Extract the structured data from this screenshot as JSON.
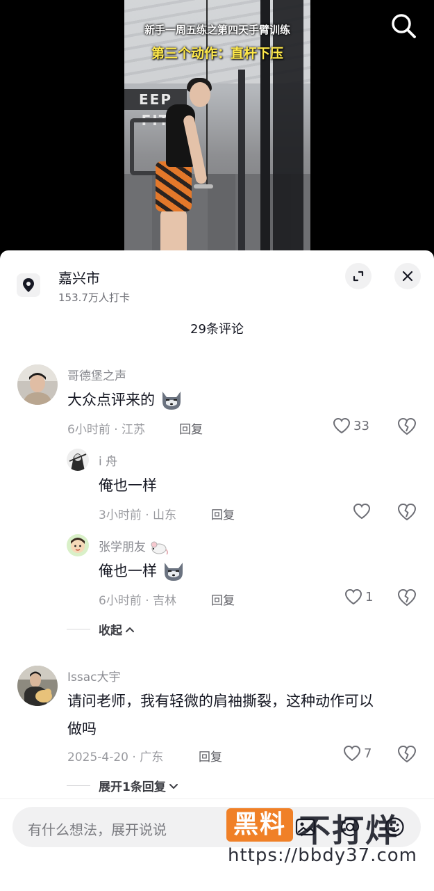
{
  "video": {
    "caption_line1": "新手一周五练之第四天手臂训练",
    "caption_line2": "第三个动作：直杆下压",
    "gym_sign": "EEP FIT"
  },
  "icons": {
    "search": "search-icon",
    "location": "location-pin-icon",
    "expand": "expand-icon",
    "close": "close-icon",
    "like": "heart-outline-icon",
    "dislike": "broken-heart-icon",
    "image": "image-icon",
    "at": "at-mention-icon",
    "emoji": "emoji-icon"
  },
  "location": {
    "name": "嘉兴市",
    "checkins": "153.7万人打卡"
  },
  "comments_header": "29条评论",
  "comments": [
    {
      "username": "哥德堡之声",
      "text": "大众点评来的",
      "meta": "6小时前 · 江苏",
      "reply_label": "回复",
      "likes": "33",
      "replies": [
        {
          "username": "i 舟",
          "text": "俺也一样",
          "meta": "3小时前 · 山东",
          "reply_label": "回复",
          "likes": ""
        },
        {
          "username": "张学朋友",
          "text": "俺也一样",
          "meta": "6小时前 · 吉林",
          "reply_label": "回复",
          "likes": "1"
        }
      ],
      "collapse_label": "收起"
    },
    {
      "username": "Issac大宇",
      "text_line1": "请问老师，我有轻微的肩袖撕裂，这种动作可以",
      "text_line2": "做吗",
      "meta": "2025-4-20 · 广东",
      "reply_label": "回复",
      "likes": "7",
      "expand_label": "展开1条回复"
    }
  ],
  "input": {
    "placeholder": "有什么想法，展开说说"
  },
  "watermark": {
    "box_text": "黑料",
    "text": "不打烊",
    "url": "https://bbdy37.com"
  },
  "colors": {
    "sheet_bg": "#ffffff",
    "text_primary": "#161823",
    "text_secondary": "#8a8b91",
    "caption_yellow": "#ffe94a",
    "watermark_orange": "#f07a1d"
  }
}
